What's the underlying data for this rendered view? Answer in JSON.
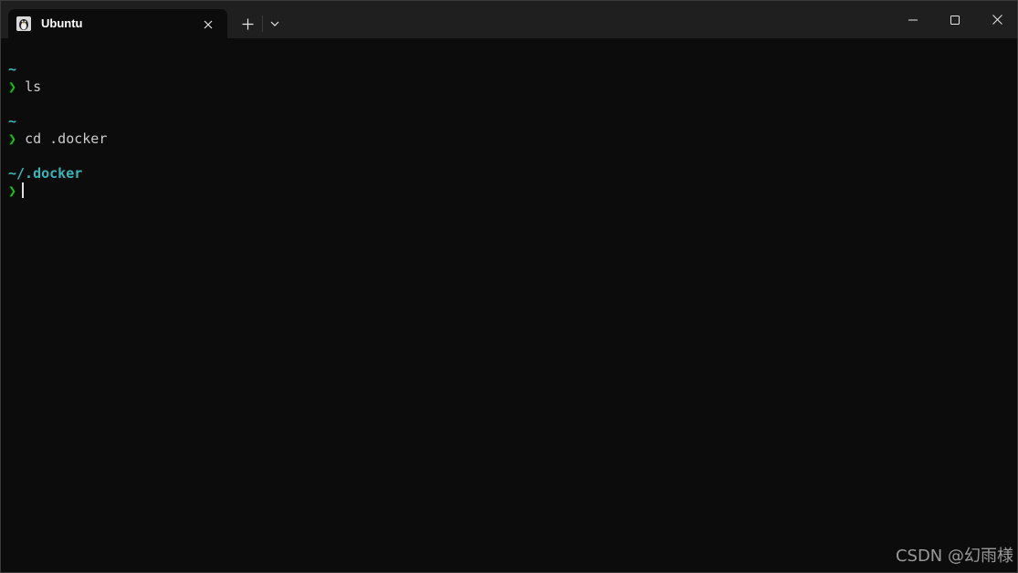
{
  "window": {
    "tab_title": "Ubuntu",
    "tab_icon": "linux-penguin-icon",
    "new_tab_icon": "plus-icon",
    "dropdown_icon": "chevron-down-icon",
    "controls": [
      "minimize-icon",
      "maximize-icon",
      "close-icon"
    ]
  },
  "terminal": {
    "lines": [
      {
        "type": "path",
        "text": "~"
      },
      {
        "type": "command",
        "prompt": "❯",
        "text": "ls"
      },
      {
        "type": "path",
        "text": "~"
      },
      {
        "type": "command",
        "prompt": "❯",
        "text": "cd .docker"
      },
      {
        "type": "path",
        "text": "~/.docker"
      },
      {
        "type": "command",
        "prompt": "❯",
        "text": ""
      }
    ],
    "colors": {
      "background": "#0c0c0c",
      "path": "#3bb4b8",
      "prompt": "#16c60c",
      "text": "#cccccc"
    }
  },
  "watermark": "CSDN @幻雨様"
}
